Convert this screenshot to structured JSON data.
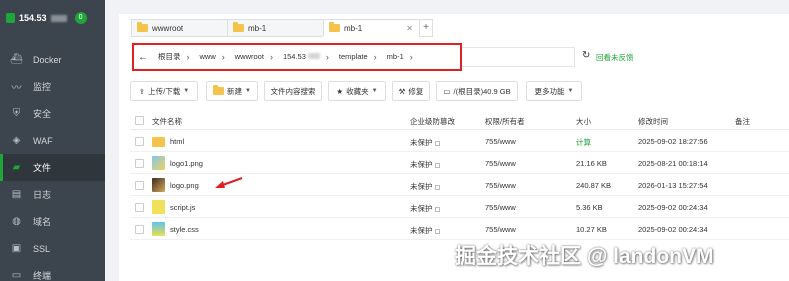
{
  "sidebar": {
    "host": "154.53",
    "badge": "0",
    "items": [
      {
        "label": "Docker",
        "icon": "docker-icon"
      },
      {
        "label": "监控",
        "icon": "monitor-icon"
      },
      {
        "label": "安全",
        "icon": "shield-icon"
      },
      {
        "label": "WAF",
        "icon": "waf-icon"
      },
      {
        "label": "文件",
        "icon": "folder-icon",
        "active": true
      },
      {
        "label": "日志",
        "icon": "log-icon"
      },
      {
        "label": "域名",
        "icon": "globe-icon"
      },
      {
        "label": "SSL",
        "icon": "ssl-icon"
      },
      {
        "label": "终端",
        "icon": "terminal-icon"
      }
    ]
  },
  "tabs": [
    {
      "label": "wwwroot"
    },
    {
      "label": "mb-1"
    },
    {
      "label": "mb-1",
      "active": true
    }
  ],
  "breadcrumb": [
    "根目录",
    "www",
    "wwwroot",
    "154.53",
    "template",
    "mb-1"
  ],
  "feedback_label": "回看未反馈",
  "toolbar": {
    "upload": "上传/下载",
    "new": "新建",
    "search": "文件内容搜索",
    "favorites": "收藏夹",
    "repair": "修复",
    "disk": "/(根目录)40.9 GB",
    "more": "更多功能"
  },
  "columns": {
    "name": "文件名称",
    "protect": "企业级防篡改",
    "perm": "权限/所有者",
    "size": "大小",
    "mtime": "修改时间",
    "note": "备注"
  },
  "files": [
    {
      "name": "html",
      "type": "folder",
      "protect": "未保护",
      "perm": "755/www",
      "size": "计算",
      "mtime": "2025-09-02 18:27:56"
    },
    {
      "name": "logo1.png",
      "type": "png",
      "protect": "未保护",
      "perm": "755/www",
      "size": "21.16 KB",
      "mtime": "2025-08-21 00:18:14"
    },
    {
      "name": "logo.png",
      "type": "png2",
      "protect": "未保护",
      "perm": "755/www",
      "size": "240.87 KB",
      "mtime": "2026-01-13 15:27:54"
    },
    {
      "name": "script.js",
      "type": "js",
      "protect": "未保护",
      "perm": "755/www",
      "size": "5.36 KB",
      "mtime": "2025-09-02 00:24:34"
    },
    {
      "name": "style.css",
      "type": "css",
      "protect": "未保护",
      "perm": "755/www",
      "size": "10.27 KB",
      "mtime": "2025-09-02 00:24:34"
    }
  ],
  "colors": {
    "accent": "#20a53a",
    "sidebar": "#3c444d",
    "highlight": "#e02020"
  },
  "watermark": "掘金技术社区 @ landonVM"
}
